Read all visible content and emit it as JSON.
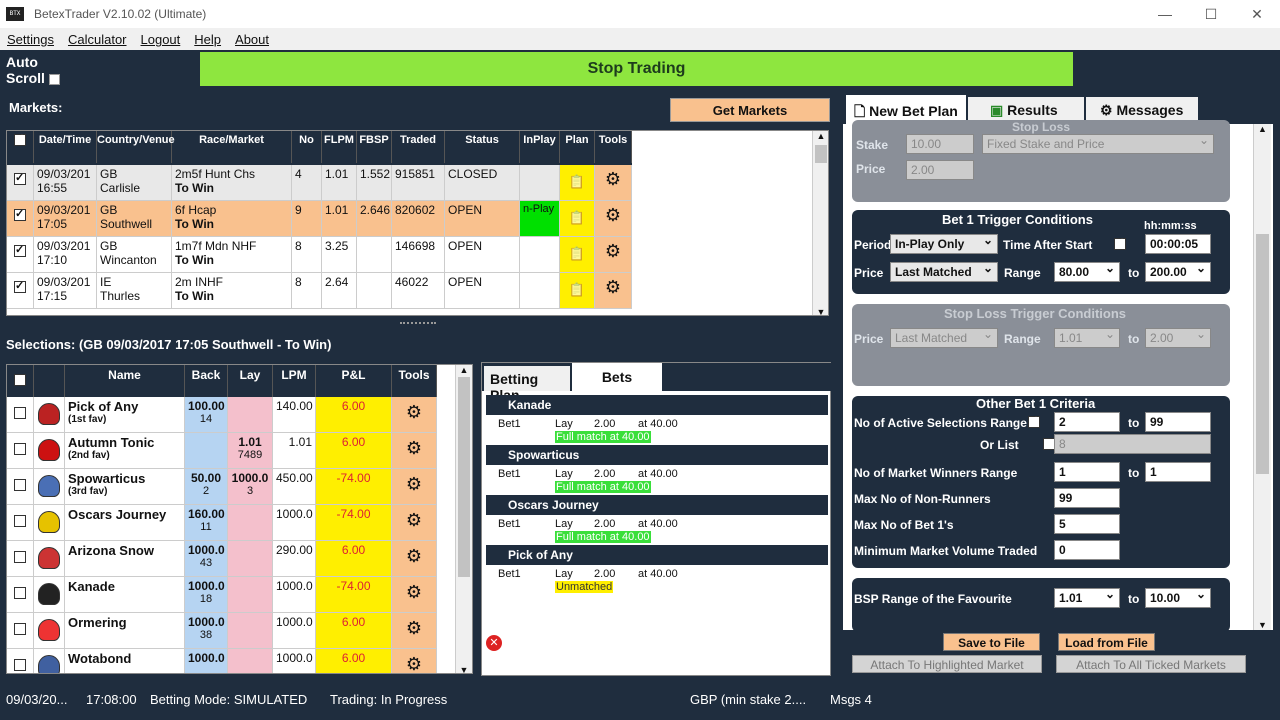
{
  "window": {
    "title": "BetexTrader V2.10.02 (Ultimate)",
    "icon_text": "BTX"
  },
  "menu": [
    "Settings",
    "Calculator",
    "Logout",
    "Help",
    "About"
  ],
  "autoscroll_label": "Auto Scroll",
  "stop_trading_label": "Stop Trading",
  "markets": {
    "label": "Markets:",
    "get_markets_label": "Get Markets",
    "columns": [
      "Date/Time",
      "Country/Venue",
      "Race/Market",
      "No",
      "FLPM",
      "FBSP",
      "Traded",
      "Status",
      "InPlay",
      "Plan",
      "Tools"
    ],
    "rows": [
      {
        "date": "09/03/201",
        "time": "16:55",
        "country": "GB",
        "venue": "Carlisle",
        "race": "2m5f Hunt Chs",
        "market": "To Win",
        "no": "4",
        "flpm": "1.01",
        "fbsp": "1.552",
        "traded": "915851",
        "status": "CLOSED",
        "inplay": ""
      },
      {
        "date": "09/03/201",
        "time": "17:05",
        "country": "GB",
        "venue": "Southwell",
        "race": "6f Hcap",
        "market": "To Win",
        "no": "9",
        "flpm": "1.01",
        "fbsp": "2.646",
        "traded": "820602",
        "status": "OPEN",
        "inplay": "n-Play"
      },
      {
        "date": "09/03/201",
        "time": "17:10",
        "country": "GB",
        "venue": "Wincanton",
        "race": "1m7f Mdn NHF",
        "market": "To Win",
        "no": "8",
        "flpm": "3.25",
        "fbsp": "",
        "traded": "146698",
        "status": "OPEN",
        "inplay": ""
      },
      {
        "date": "09/03/201",
        "time": "17:15",
        "country": "IE",
        "venue": "Thurles",
        "race": "2m INHF",
        "market": "To Win",
        "no": "8",
        "flpm": "2.64",
        "fbsp": "",
        "traded": "46022",
        "status": "OPEN",
        "inplay": ""
      }
    ]
  },
  "selections": {
    "label": "Selections:  (GB 09/03/2017 17:05 Southwell - To Win)",
    "columns": [
      "Name",
      "Back",
      "Lay",
      "LPM",
      "P&L",
      "Tools"
    ],
    "rows": [
      {
        "name": "Pick of Any",
        "sub": "(1st fav)",
        "back": "100.00",
        "back_vol": "14",
        "lay": "",
        "lay_vol": "",
        "lpm": "140.00",
        "pl": "6.00",
        "pl_neg": false
      },
      {
        "name": "Autumn Tonic",
        "sub": "(2nd fav)",
        "back": "",
        "back_vol": "",
        "lay": "1.01",
        "lay_vol": "7489",
        "lpm": "1.01",
        "pl": "6.00",
        "pl_neg": false
      },
      {
        "name": "Spowarticus",
        "sub": "(3rd fav)",
        "back": "50.00",
        "back_vol": "2",
        "lay": "1000.0",
        "lay_vol": "3",
        "lpm": "450.00",
        "pl": "-74.00",
        "pl_neg": true
      },
      {
        "name": "Oscars Journey",
        "sub": "",
        "back": "160.00",
        "back_vol": "11",
        "lay": "",
        "lay_vol": "",
        "lpm": "1000.0",
        "pl": "-74.00",
        "pl_neg": true
      },
      {
        "name": "Arizona Snow",
        "sub": "",
        "back": "1000.0",
        "back_vol": "43",
        "lay": "",
        "lay_vol": "",
        "lpm": "290.00",
        "pl": "6.00",
        "pl_neg": false
      },
      {
        "name": "Kanade",
        "sub": "",
        "back": "1000.0",
        "back_vol": "18",
        "lay": "",
        "lay_vol": "",
        "lpm": "1000.0",
        "pl": "-74.00",
        "pl_neg": true
      },
      {
        "name": "Ormering",
        "sub": "",
        "back": "1000.0",
        "back_vol": "38",
        "lay": "",
        "lay_vol": "",
        "lpm": "1000.0",
        "pl": "6.00",
        "pl_neg": false
      },
      {
        "name": "Wotabond",
        "sub": "",
        "back": "1000.0",
        "back_vol": "",
        "lay": "",
        "lay_vol": "",
        "lpm": "1000.0",
        "pl": "6.00",
        "pl_neg": false
      }
    ]
  },
  "bets": {
    "tabs": [
      "Betting Plan",
      "Bets"
    ],
    "groups": [
      {
        "name": "Kanade",
        "bet": "Bet1",
        "type": "Lay",
        "price": "2.00",
        "at": "at 40.00",
        "status": "Full match at 40.00",
        "matched": true
      },
      {
        "name": "Spowarticus",
        "bet": "Bet1",
        "type": "Lay",
        "price": "2.00",
        "at": "at 40.00",
        "status": "Full match at 40.00",
        "matched": true
      },
      {
        "name": "Oscars Journey",
        "bet": "Bet1",
        "type": "Lay",
        "price": "2.00",
        "at": "at 40.00",
        "status": "Full match at 40.00",
        "matched": true
      },
      {
        "name": "Pick of Any",
        "bet": "Bet1",
        "type": "Lay",
        "price": "2.00",
        "at": "at 40.00",
        "status": "Unmatched",
        "matched": false
      }
    ]
  },
  "right_tabs": [
    "New Bet Plan",
    "Results",
    "Messages"
  ],
  "stop_loss": {
    "title": "Stop Loss",
    "stake_label": "Stake",
    "stake": "10.00",
    "price_label": "Price",
    "price": "2.00",
    "mode": "Fixed Stake and Price"
  },
  "trigger": {
    "title": "Bet 1 Trigger Conditions",
    "time_header": "hh:mm:ss",
    "period_label": "Period",
    "period": "In-Play Only",
    "time_after_label": "Time After Start",
    "time_after": "00:00:05",
    "price_label": "Price",
    "price": "Last Matched",
    "range_label": "Range",
    "range_from": "80.00",
    "to_label": "to",
    "range_to": "200.00"
  },
  "sl_trigger": {
    "title": "Stop Loss Trigger Conditions",
    "price_label": "Price",
    "price": "Last Matched",
    "range_label": "Range",
    "range_from": "1.01",
    "to_label": "to",
    "range_to": "2.00"
  },
  "other": {
    "title": "Other Bet 1 Criteria",
    "active_label": "No of Active Selections Range",
    "active_from": "2",
    "active_to": "99",
    "orlist_label": "Or List",
    "orlist": "8",
    "winners_label": "No of Market Winners Range",
    "winners_from": "1",
    "winners_to": "1",
    "nonrunners_label": "Max No of Non-Runners",
    "nonrunners": "99",
    "maxbets_label": "Max No of Bet 1's",
    "maxbets": "5",
    "minvol_label": "Minimum Market Volume Traded",
    "minvol": "0",
    "to_label": "to"
  },
  "bsp": {
    "label": "BSP Range of the Favourite",
    "from": "1.01",
    "to_label": "to",
    "to": "10.00"
  },
  "actions": {
    "save": "Save to File",
    "load": "Load from File",
    "attach_highlighted": "Attach To Highlighted Market",
    "attach_all": "Attach To All Ticked Markets"
  },
  "status": [
    "09/03/20...",
    "17:08:00",
    "Betting Mode: SIMULATED",
    "Trading: In Progress",
    "GBP (min stake 2....",
    "Msgs 4"
  ]
}
